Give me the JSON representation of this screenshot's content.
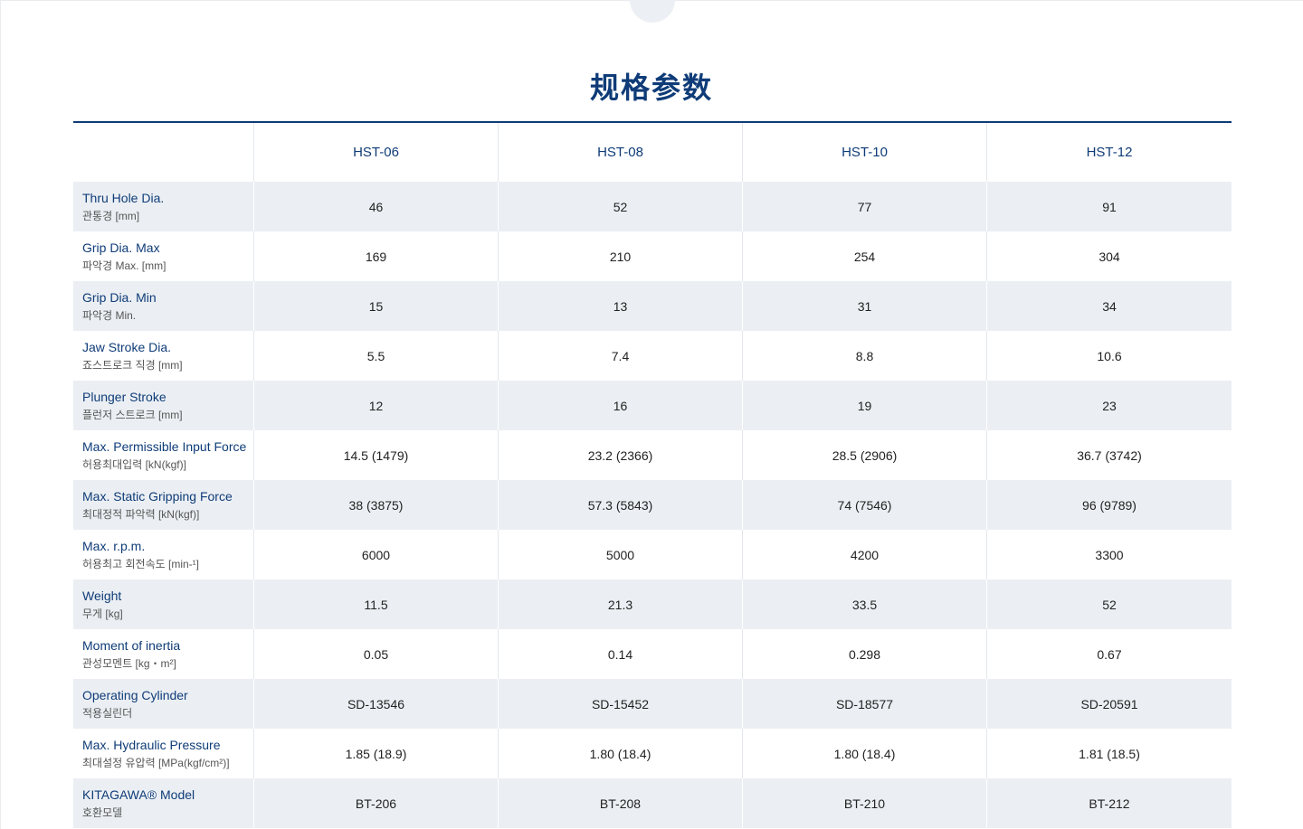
{
  "title": "规格参数",
  "models": [
    "HST-06",
    "HST-08",
    "HST-10",
    "HST-12"
  ],
  "rows": [
    {
      "en": "Thru Hole Dia.",
      "ko": "관통경 [mm]",
      "values": [
        "46",
        "52",
        "77",
        "91"
      ]
    },
    {
      "en": "Grip Dia. Max",
      "ko": "파악경 Max. [mm]",
      "values": [
        "169",
        "210",
        "254",
        "304"
      ]
    },
    {
      "en": "Grip Dia. Min",
      "ko": "파악경 Min.",
      "values": [
        "15",
        "13",
        "31",
        "34"
      ]
    },
    {
      "en": "Jaw Stroke Dia.",
      "ko": "죠스트로크 직경 [mm]",
      "values": [
        "5.5",
        "7.4",
        "8.8",
        "10.6"
      ]
    },
    {
      "en": "Plunger Stroke",
      "ko": "플런저 스트로크 [mm]",
      "values": [
        "12",
        "16",
        "19",
        "23"
      ]
    },
    {
      "en": "Max. Permissible Input Force",
      "ko": "허용최대입력 [kN(kgf)]",
      "values": [
        "14.5 (1479)",
        "23.2 (2366)",
        "28.5 (2906)",
        "36.7 (3742)"
      ]
    },
    {
      "en": "Max. Static Gripping Force",
      "ko": "최대정적 파악력 [kN(kgf)]",
      "values": [
        "38 (3875)",
        "57.3 (5843)",
        "74 (7546)",
        "96 (9789)"
      ]
    },
    {
      "en": "Max. r.p.m.",
      "ko": "허용최고 회전속도 [min-¹]",
      "values": [
        "6000",
        "5000",
        "4200",
        "3300"
      ]
    },
    {
      "en": "Weight",
      "ko": "무게 [kg]",
      "values": [
        "11.5",
        "21.3",
        "33.5",
        "52"
      ]
    },
    {
      "en": "Moment of inertia",
      "ko": "관성모멘트 [kg・m²]",
      "values": [
        "0.05",
        "0.14",
        "0.298",
        "0.67"
      ]
    },
    {
      "en": "Operating Cylinder",
      "ko": "적용실린더",
      "values": [
        "SD-13546",
        "SD-15452",
        "SD-18577",
        "SD-20591"
      ]
    },
    {
      "en": "Max. Hydraulic Pressure",
      "ko": "최대설정 유압력 [MPa(kgf/cm²)]",
      "values": [
        "1.85 (18.9)",
        "1.80 (18.4)",
        "1.80 (18.4)",
        "1.81 (18.5)"
      ]
    },
    {
      "en": "KITAGAWA® Model",
      "ko": "호환모델",
      "values": [
        "BT-206",
        "BT-208",
        "BT-210",
        "BT-212"
      ]
    }
  ]
}
